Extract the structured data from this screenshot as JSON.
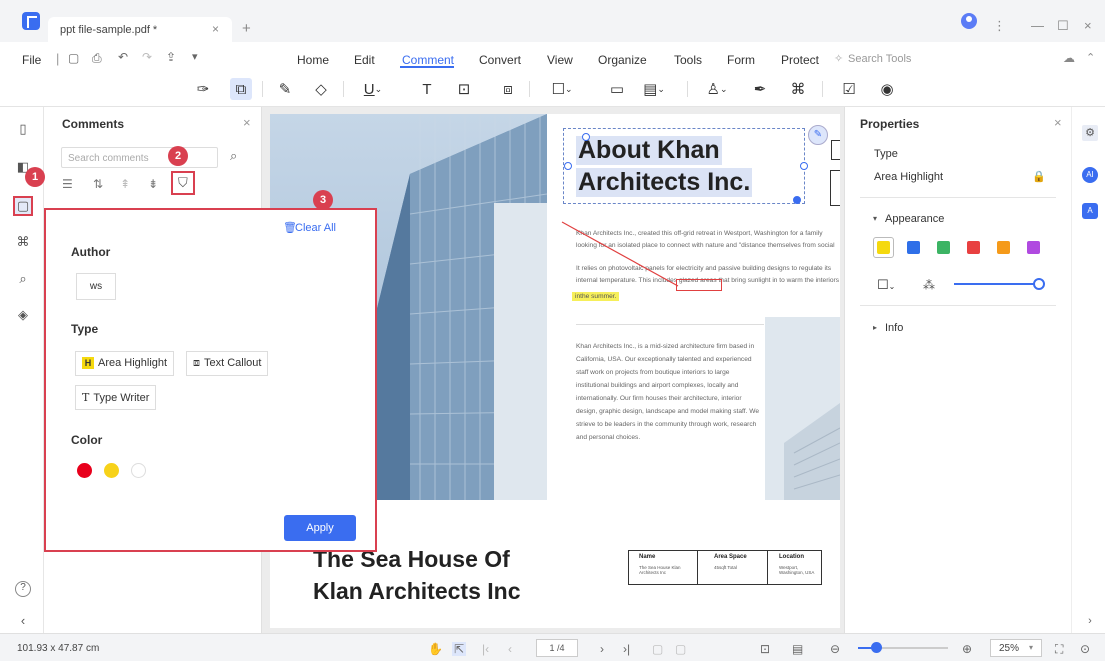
{
  "titlebar": {
    "tab_title": "ppt file-sample.pdf *",
    "tab_close": "×",
    "new_tab": "+",
    "more": "⋮",
    "minimize": "—",
    "maximize": "☐",
    "close": "×"
  },
  "menu": {
    "file": "File",
    "items": [
      "Home",
      "Edit",
      "Comment",
      "Convert",
      "View",
      "Organize",
      "Tools",
      "Form",
      "Protect"
    ],
    "search_placeholder": "Search Tools"
  },
  "comments_panel": {
    "title": "Comments",
    "close": "×",
    "search_placeholder": "Search comments"
  },
  "filter_popup": {
    "clear_all": "Clear All",
    "author_label": "Author",
    "author_value": "ws",
    "type_label": "Type",
    "types": [
      "Area Highlight",
      "Text Callout",
      "Type Writer"
    ],
    "color_label": "Color",
    "colors": [
      "#e8001c",
      "#f7d21a",
      "#ffffff"
    ],
    "apply": "Apply"
  },
  "callouts": [
    "1",
    "2",
    "3"
  ],
  "document": {
    "heading_line1": "About Khan",
    "heading_line2": "Architects Inc.",
    "para1": "Khan Architects Inc., created this off-grid retreat in Westport, Washington for a family looking for an isolated place to connect with nature and \"distance themselves from social stresses\".",
    "para2": "It relies on photovoltaic panels for electricity and passive building designs to regulate its internal temperature. This includes glazed areas that bring sunlight in to warm the interiors in winter, while on extended west-facing roofs provide shade from solar heat during evenings",
    "highlighted": "inthe summer.",
    "para3": "Khan Architects Inc., is a mid-sized architecture firm based in California, USA. Our exceptionally talented and experienced staff work on projects from boutique interiors to large institutional buildings and airport complexes, locally and internationally. Our firm houses their architecture, interior design, graphic design, landscape and model making staff. We strieve to be leaders in the community through work, research and personal choices.",
    "sea_line1": "The Sea House Of",
    "sea_line2": "Klan Architects Inc",
    "table": {
      "headers": [
        "Name",
        "Area Space",
        "Location"
      ],
      "cells": [
        "The Sea House Klan Architects Inc",
        "45sqft Total",
        "Westport, Washington, USA"
      ]
    }
  },
  "properties": {
    "title": "Properties",
    "close": "×",
    "type_label": "Type",
    "type_value": "Area Highlight",
    "appearance": "Appearance",
    "colors": [
      "#f5d90e",
      "#2f6fe8",
      "#3cb464",
      "#e84040",
      "#f59a1a",
      "#b04ae0"
    ],
    "opacity": 1.0,
    "info": "Info"
  },
  "statusbar": {
    "dimensions": "101.93 x 47.87 cm",
    "page": "1 /4",
    "zoom": "25%",
    "zoom_level": 0.25
  }
}
